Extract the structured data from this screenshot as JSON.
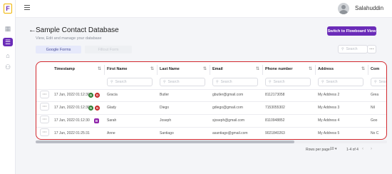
{
  "app": {
    "logo_letter": "F"
  },
  "sidebar": {
    "items": [
      {
        "name": "grid",
        "glyph": "▦"
      },
      {
        "name": "list",
        "glyph": "☰"
      },
      {
        "name": "home",
        "glyph": "⌂"
      },
      {
        "name": "users",
        "glyph": "⚇"
      }
    ]
  },
  "topbar": {
    "username": "Salahuddin",
    "chevron": "⌄"
  },
  "page": {
    "back": "←",
    "title": "Sample Contact Database",
    "subtitle": "View, Edit and manage your database",
    "switch_button": "Switch to Flowboard View"
  },
  "tabs": {
    "google_forms": "Google Forms",
    "other": "Fillout Form"
  },
  "search": {
    "placeholder": "Search",
    "icon": "⚲"
  },
  "more": "⋯",
  "table": {
    "headers": [
      "Timestamp",
      "First Name",
      "Last Name",
      "Email",
      "Phone number",
      "Address",
      "Com"
    ],
    "filter_placeholder": "Search",
    "rows": [
      {
        "timestamp": "17 Jun, 2022 01:12:30",
        "first": "Gracia",
        "last": "Butler",
        "email": "gbutler@gmail.com",
        "phone": "8112173058",
        "address": "My Address 2",
        "com": "Grea",
        "badges": [
          {
            "t": "G",
            "c": "#2e7d32"
          },
          {
            "t": "G",
            "c": "#c62828"
          }
        ]
      },
      {
        "timestamp": "17 Jun, 2022 01:12:30",
        "first": "Glady",
        "last": "Diego",
        "email": "gdiego@gmail.com",
        "phone": "7153055302",
        "address": "My Address 3",
        "com": "Nil",
        "badges": [
          {
            "t": "G",
            "c": "#2e7d32"
          },
          {
            "t": "G",
            "c": "#c62828"
          }
        ]
      },
      {
        "timestamp": "17 Jun, 2022 01:12:30",
        "first": "Sarah",
        "last": "Joseph",
        "email": "sjoseph@gmail.com",
        "phone": "8110948852",
        "address": "My Address 4",
        "com": "Goo",
        "badges": [
          {
            "t": "B",
            "c": "#8e24aa"
          }
        ]
      },
      {
        "timestamp": "17 Jun, 2022 01:25:31",
        "first": "Anne",
        "last": "Santiago",
        "email": "asantiago@gmail.com",
        "phone": "9021840263",
        "address": "My Address 5",
        "com": "No C",
        "badges": []
      }
    ]
  },
  "pagination": {
    "rows_per_page_label": "Rows per page:",
    "rows_per_page": "10 ▾",
    "range": "1-4 of 4",
    "first": "|‹",
    "prev": "‹",
    "next": "›",
    "last": "›|"
  }
}
